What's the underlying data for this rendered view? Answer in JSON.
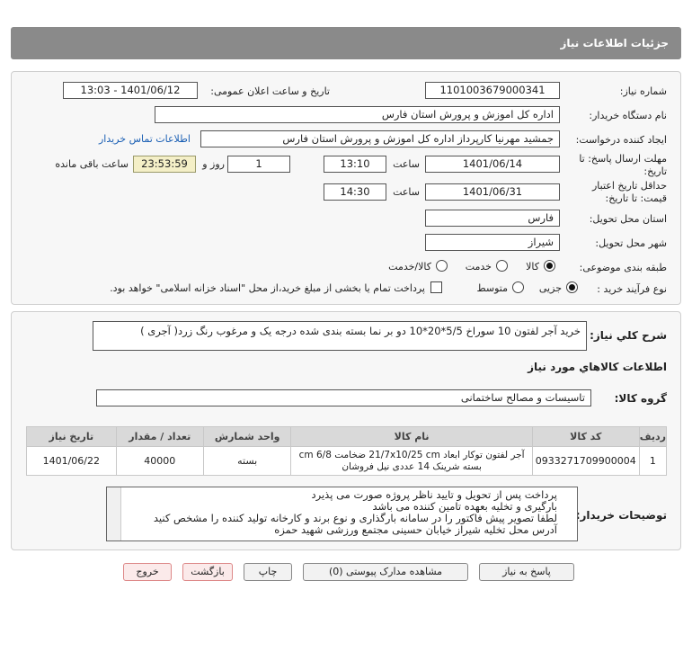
{
  "header": {
    "title": "جزئیات اطلاعات نیاز"
  },
  "form": {
    "need_number_label": "شماره نیاز:",
    "need_number": "1101003679000341",
    "announce_label": "تاریخ و ساعت اعلان عمومی:",
    "announce_value": "1401/06/12 - 13:03",
    "buyer_org_label": "نام دستگاه خریدار:",
    "buyer_org": "اداره کل اموزش و پرورش استان فارس",
    "creator_label": "ایجاد کننده درخواست:",
    "creator": "جمشید مهرنیا کارپرداز اداره کل اموزش و پرورش استان فارس",
    "contact_link": "اطلاعات تماس خریدار",
    "reply_deadline_label": "مهلت ارسال پاسخ: تا تاریخ:",
    "reply_date": "1401/06/14",
    "time_word": "ساعت",
    "reply_time": "13:10",
    "days_count": "1",
    "days_and": "روز و",
    "remaining_time": "23:53:59",
    "remaining_label": "ساعت باقی مانده",
    "price_validity_label": "حداقل تاریخ اعتبار قیمت: تا تاریخ:",
    "validity_date": "1401/06/31",
    "validity_time": "14:30",
    "province_label": "استان محل تحویل:",
    "province": "فارس",
    "city_label": "شهر محل تحویل:",
    "city": "شیراز",
    "category_label": "طبقه بندی موضوعی:",
    "category_options": [
      "کالا",
      "خدمت",
      "کالا/خدمت"
    ],
    "category_selected": "کالا",
    "process_label": "نوع فرآیند خرید :",
    "process_options": [
      "جزیی",
      "متوسط"
    ],
    "process_selected": "جزیی",
    "payment_note": "پرداخت تمام یا بخشی از مبلغ خرید،از محل \"اسناد خزانه اسلامی\" خواهد بود."
  },
  "summary": {
    "label": "شرح کلي نياز:",
    "text": "خرید آجر لفتون 10 سوراخ 5/5*20*10  دو بر نما بسته بندی شده درجه یک و مرغوب رنگ زرد( آجری )"
  },
  "goods": {
    "section_title": "اطلاعات کالاهاي مورد نياز",
    "group_label": "گروه کالا:",
    "group_value": "تاسیسات و مصالح ساختمانی",
    "table_headers": [
      "ردیف",
      "کد کالا",
      "نام کالا",
      "واحد شمارش",
      "تعداد / مقدار",
      "تاریخ نیاز"
    ],
    "rows": [
      {
        "row": "1",
        "code": "0933271709900004",
        "name": "آجر لفتون توکار ابعاد 21/7x10/25 cm ضخامت 6/8 cm بسته شرینک 14 عددی نیل فروشان",
        "unit": "بسته",
        "qty": "40000",
        "date": "1401/06/22"
      }
    ]
  },
  "notes": {
    "label": "توضیحات خریدار:",
    "lines": [
      "پرداخت پس از تحویل و تایید ناظر پروژه صورت می پذیرد",
      "بارگیری و تخلیه بعهده تامین کننده می باشد",
      "لطفا تصویر پیش فاکتور را در سامانه بارگذاری و نوع برند و کارخانه تولید کننده را مشخص کنید",
      "آدرس محل تخلیه شیراز خیابان حسینی مجتمع ورزشی شهید حمزه"
    ]
  },
  "buttons": {
    "reply": "پاسخ به نیاز",
    "attachments": "مشاهده مدارک پیوستی (0)",
    "print": "چاپ",
    "back": "بازگشت",
    "exit": "خروج"
  }
}
